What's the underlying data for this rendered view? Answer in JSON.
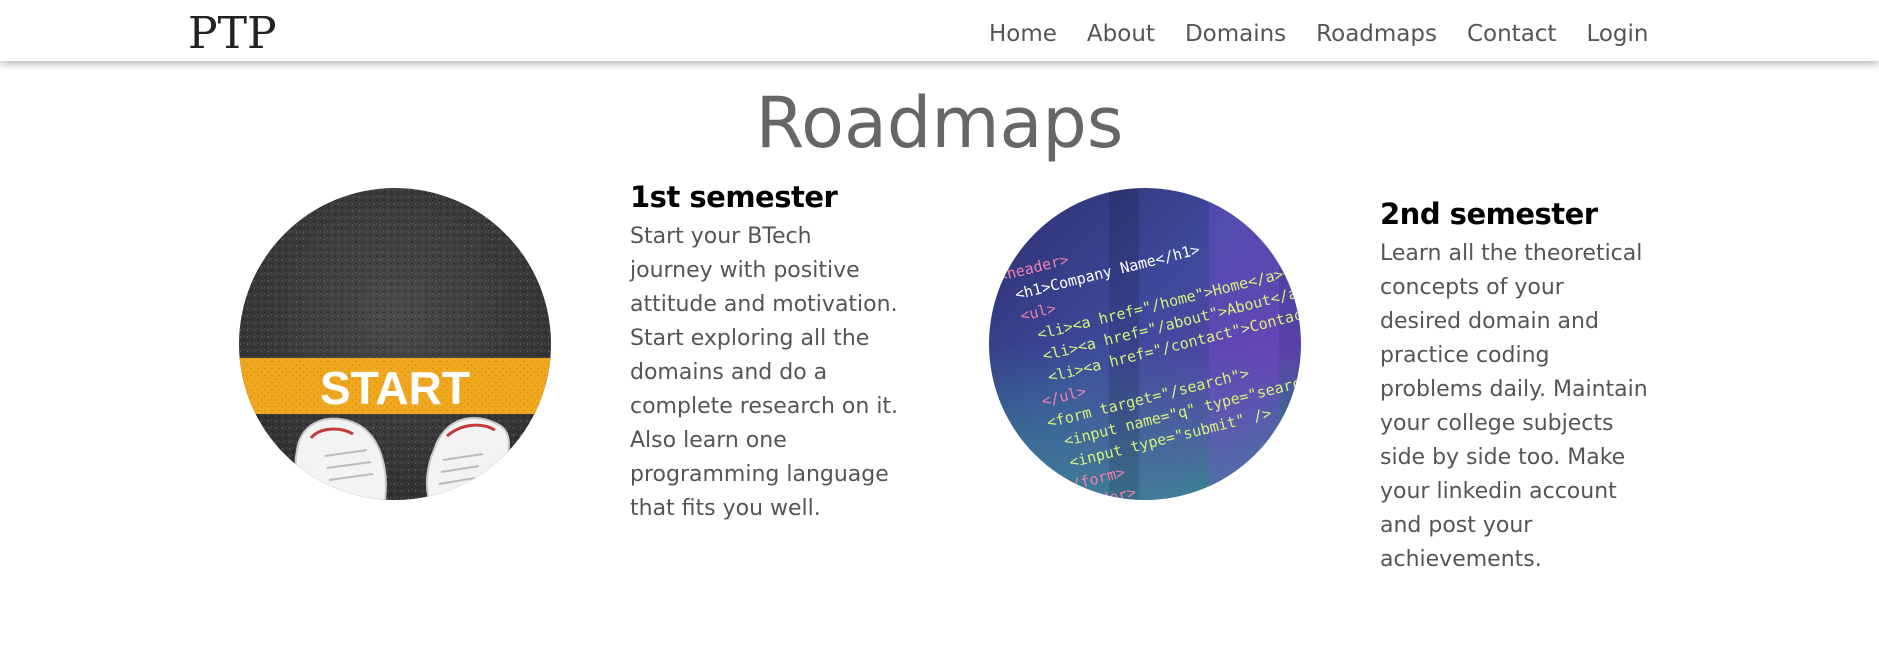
{
  "header": {
    "brand": "PTP",
    "nav": [
      "Home",
      "About",
      "Domains",
      "Roadmaps",
      "Contact",
      "Login"
    ]
  },
  "main": {
    "title": "Roadmaps",
    "cards": [
      {
        "title": "1st semester",
        "description": "Start your BTech journey with positive attitude and motivation. Start exploring all the domains and do a complete research on it. Also learn one programming language that fits you well.",
        "image_text": "START"
      },
      {
        "title": "2nd semester",
        "description": "Learn all the theoretical concepts of your desired domain and practice coding problems daily. Maintain your college subjects side by side too. Make your linkedin account and post your achievements.",
        "image_code_lines": [
          "<header>",
          "<h1>Company Name</h1>",
          "<ul>",
          "<li><a href=\"/home\">Home</a></li>",
          "<li><a href=\"/about\">About</a></li>",
          "<li><a href=\"/contact\">Contact us</a></li>",
          "</ul>",
          "<form target=\"/search\">",
          "<input name=\"q\" type=\"search\" />",
          "<input type=\"submit\" />",
          "</form>",
          "</header>"
        ]
      }
    ]
  },
  "colors": {
    "text_gray": "#555555",
    "title_gray": "#666666",
    "heading_black": "#000000",
    "start_stripe": "#f2a81d",
    "asphalt": "#3a3a3c",
    "code_bg": "#3a3f8f"
  }
}
